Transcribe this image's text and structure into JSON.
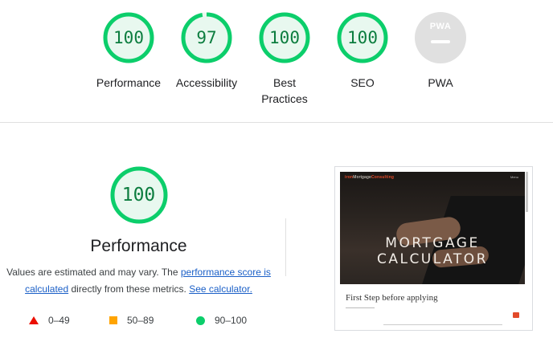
{
  "categories": [
    {
      "score": "100",
      "label": "Performance"
    },
    {
      "score": "97",
      "label": "Accessibility"
    },
    {
      "score": "100",
      "label": "Best Practices"
    },
    {
      "score": "100",
      "label": "SEO"
    },
    {
      "score": "",
      "label": "PWA"
    }
  ],
  "pwa_badge": "PWA",
  "performance": {
    "score": "100",
    "title": "Performance",
    "desc_prefix": "Values are estimated and may vary. The ",
    "link_score": "performance score is calculated",
    "desc_middle": " directly from these metrics. ",
    "link_calc": "See calculator."
  },
  "legend": [
    {
      "range": "0–49",
      "shape": "triangle",
      "color": "#eb0f00"
    },
    {
      "range": "50–89",
      "shape": "square",
      "color": "#ffa400"
    },
    {
      "range": "90–100",
      "shape": "circle",
      "color": "#0cce6b"
    }
  ],
  "screenshot": {
    "brand_a": "iron",
    "brand_b": "Mortgage",
    "brand_c": "Consulting",
    "nav": "Menu",
    "heading": "MORTGAGE CALCULATOR",
    "subheading": "First Step before applying"
  },
  "colors": {
    "pass": "#0cce6b",
    "pass_text": "#0c7d3f",
    "pass_fill": "#e8f8ef",
    "na": "#e0e0e0"
  }
}
